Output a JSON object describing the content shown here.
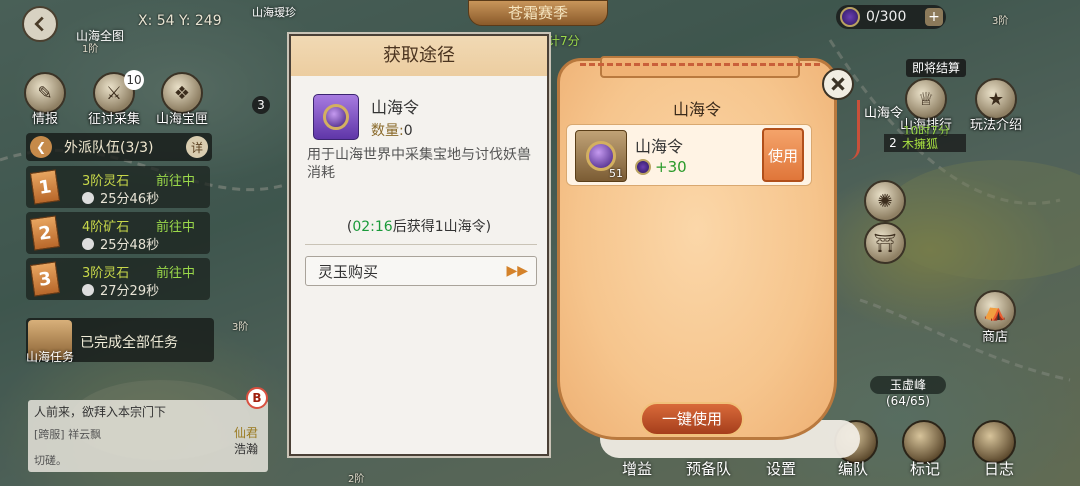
{
  "map": {
    "coords": "X:  54  Y:  249",
    "map_all_label": "山海全图",
    "level_1": "1阶",
    "level_2": "2阶",
    "level_3": "3阶",
    "title_banner": "苍霜赛季",
    "top_fragment": "山海瑷珍",
    "time_fragment": "计7分",
    "buttons": {
      "intel": "情报",
      "expedition": "征讨采集",
      "expedition_badge": "10",
      "treasure": "山海宝匣",
      "treasure_badge": "3",
      "seal": "山海令",
      "rank": "山海排行",
      "guide": "玩法介绍",
      "shop": "商店"
    },
    "currency": {
      "value": "0/300",
      "plus": "+"
    }
  },
  "team_panel": {
    "header": "外派队伍(3/3)",
    "detail_btn": "详",
    "rows": [
      {
        "num": "1",
        "name": "3阶灵石",
        "status": "前往中",
        "timer": "25分46秒"
      },
      {
        "num": "2",
        "name": "4阶矿石",
        "status": "前往中",
        "timer": "25分48秒"
      },
      {
        "num": "3",
        "name": "3阶灵石",
        "status": "前往中",
        "timer": "27分29秒"
      }
    ]
  },
  "task": {
    "label": "山海任务",
    "text": "已完成全部任务"
  },
  "chat": {
    "line1": "人前来，欲拜入本宗门下",
    "line2": "[跨服] 祥云飘",
    "line3": "切磋。",
    "xian": "仙君",
    "hao": "浩瀚",
    "badge": "B"
  },
  "right": {
    "settle": "即将结算",
    "time_left": "10时7分",
    "rank_num": "2",
    "rank_name": "木擁狐",
    "peak_name": "玉虚峰",
    "peak_count": "(64/65)"
  },
  "bottom": {
    "gain": "增益",
    "reserve": "预备队",
    "settings": "设置",
    "formation": "编队",
    "mark": "标记",
    "log": "日志"
  },
  "dialog": {
    "title": "获取途径",
    "item_name": "山海令",
    "qty_label": "数量:",
    "qty_value": "0",
    "description": "用于山海世界中采集宝地与讨伐妖兽消耗",
    "timer_time": "02:16",
    "timer_suffix": "后获得1山海令",
    "timer_open": "(",
    "timer_close": ")",
    "buy_label": "灵玉购买"
  },
  "bag": {
    "title": "山海令",
    "item_name": "山海令",
    "item_count": "51",
    "reward": "+30",
    "use_label": "使用",
    "onekey_label": "一键使用"
  }
}
